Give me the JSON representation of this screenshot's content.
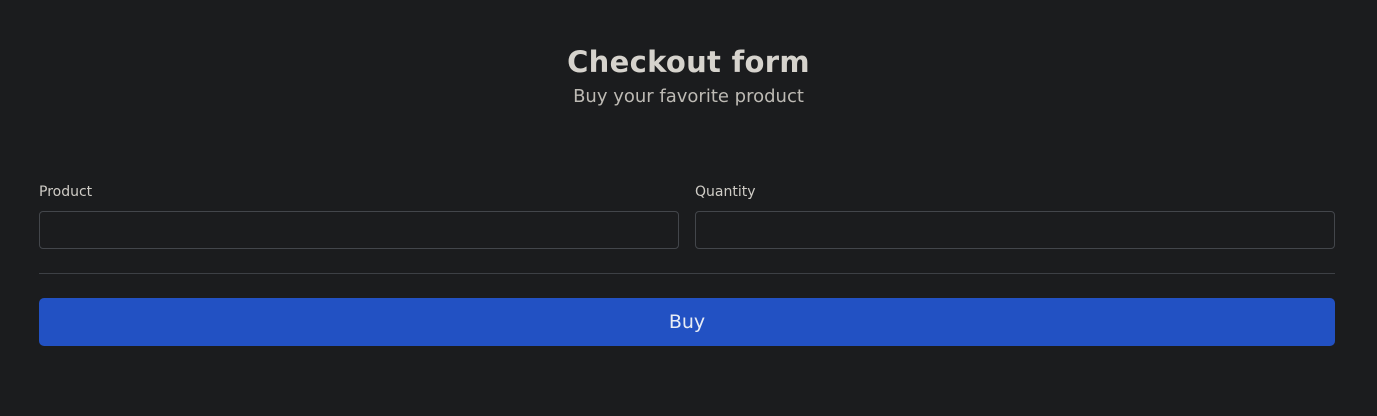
{
  "header": {
    "title": "Checkout form",
    "subtitle": "Buy your favorite product"
  },
  "form": {
    "product": {
      "label": "Product",
      "value": "",
      "placeholder": ""
    },
    "quantity": {
      "label": "Quantity",
      "value": "",
      "placeholder": ""
    },
    "buy_label": "Buy"
  },
  "colors": {
    "background": "#1b1c1e",
    "accent": "#2251c3",
    "text": "#d6d3cd"
  }
}
